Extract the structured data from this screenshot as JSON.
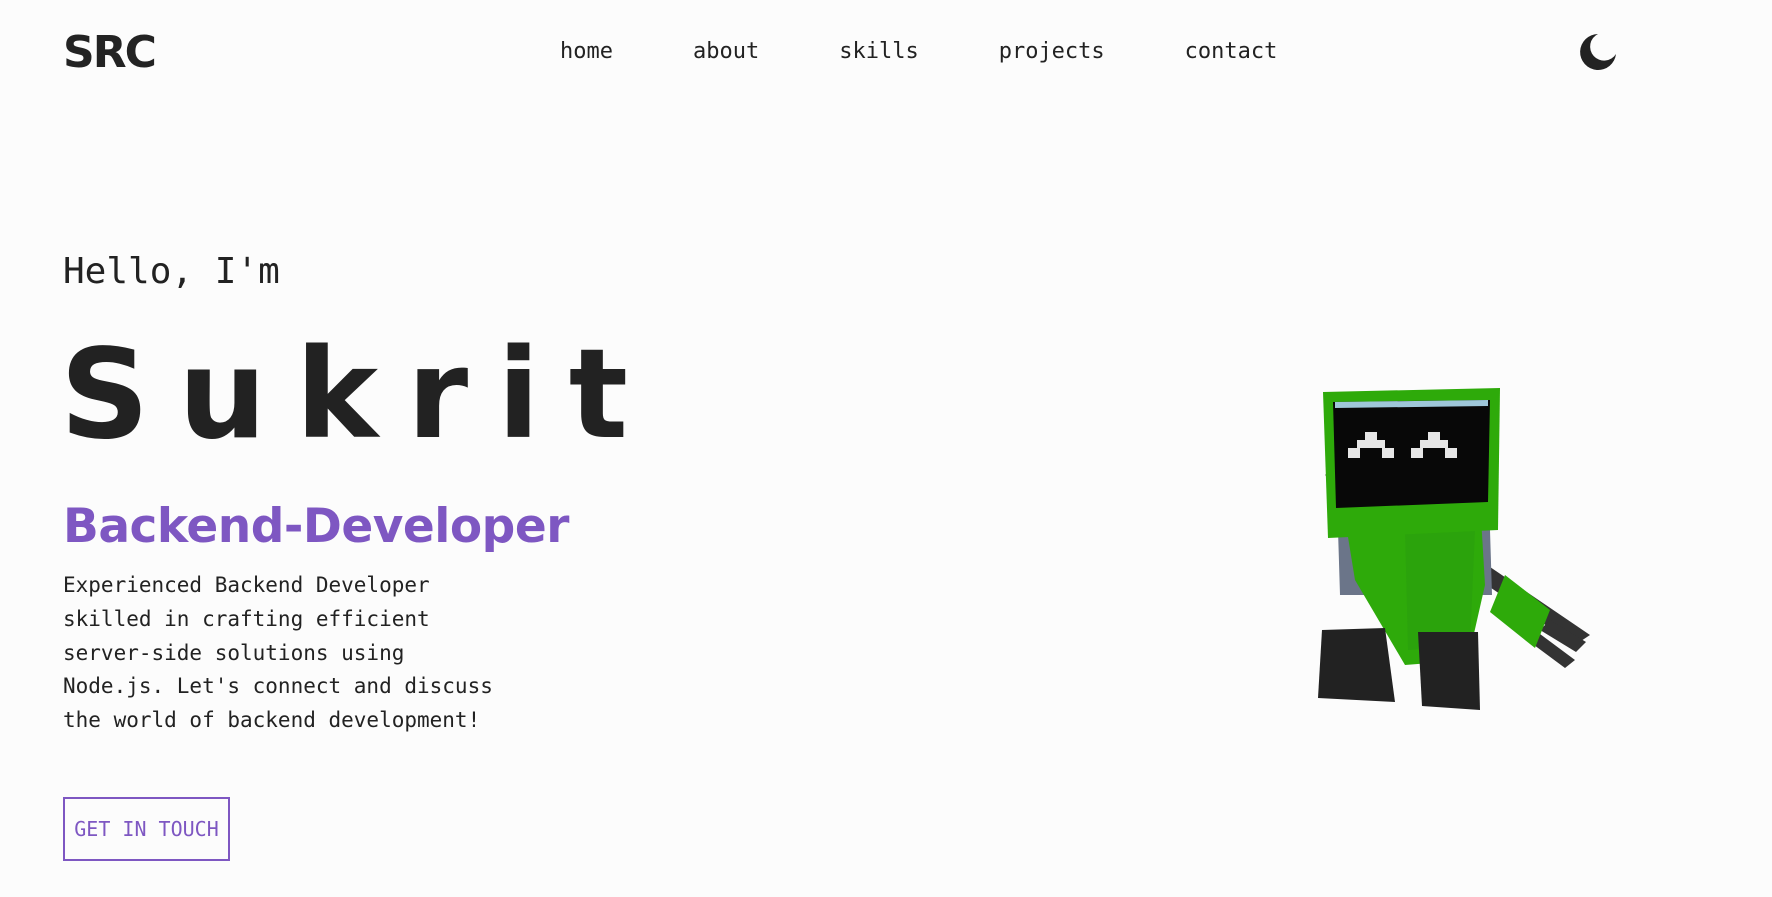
{
  "brand": {
    "logo": "SRC"
  },
  "nav": {
    "items": [
      "home",
      "about",
      "skills",
      "projects",
      "contact"
    ]
  },
  "hero": {
    "greeting": "Hello, I'm",
    "name": "Sukrit",
    "role": "Backend-Developer",
    "description": "Experienced Backend Developer skilled in crafting efficient server-side solutions using Node.js. Let's connect and discuss the world of backend development!",
    "cta_label": "GET IN TOUCH"
  },
  "icons": {
    "theme_toggle": "moon-icon",
    "illustration": "robot-illustration"
  },
  "colors": {
    "accent": "#7e57c2",
    "text": "#222222",
    "background": "#fcfcfc",
    "robot_green": "#2eaa0a"
  }
}
